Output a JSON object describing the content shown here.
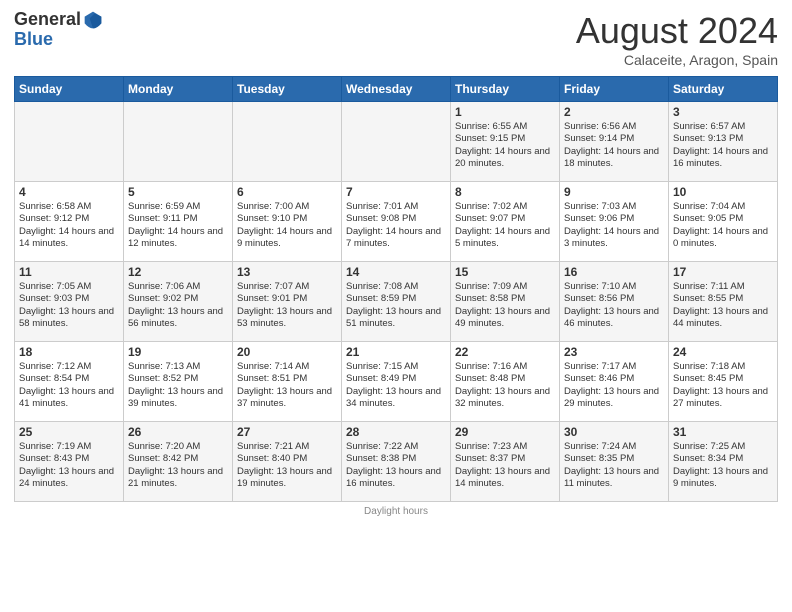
{
  "header": {
    "logo_general": "General",
    "logo_blue": "Blue",
    "month_title": "August 2024",
    "location": "Calaceite, Aragon, Spain"
  },
  "weekdays": [
    "Sunday",
    "Monday",
    "Tuesday",
    "Wednesday",
    "Thursday",
    "Friday",
    "Saturday"
  ],
  "weeks": [
    [
      {
        "day": "",
        "info": ""
      },
      {
        "day": "",
        "info": ""
      },
      {
        "day": "",
        "info": ""
      },
      {
        "day": "",
        "info": ""
      },
      {
        "day": "1",
        "info": "Sunrise: 6:55 AM\nSunset: 9:15 PM\nDaylight: 14 hours and 20 minutes."
      },
      {
        "day": "2",
        "info": "Sunrise: 6:56 AM\nSunset: 9:14 PM\nDaylight: 14 hours and 18 minutes."
      },
      {
        "day": "3",
        "info": "Sunrise: 6:57 AM\nSunset: 9:13 PM\nDaylight: 14 hours and 16 minutes."
      }
    ],
    [
      {
        "day": "4",
        "info": "Sunrise: 6:58 AM\nSunset: 9:12 PM\nDaylight: 14 hours and 14 minutes."
      },
      {
        "day": "5",
        "info": "Sunrise: 6:59 AM\nSunset: 9:11 PM\nDaylight: 14 hours and 12 minutes."
      },
      {
        "day": "6",
        "info": "Sunrise: 7:00 AM\nSunset: 9:10 PM\nDaylight: 14 hours and 9 minutes."
      },
      {
        "day": "7",
        "info": "Sunrise: 7:01 AM\nSunset: 9:08 PM\nDaylight: 14 hours and 7 minutes."
      },
      {
        "day": "8",
        "info": "Sunrise: 7:02 AM\nSunset: 9:07 PM\nDaylight: 14 hours and 5 minutes."
      },
      {
        "day": "9",
        "info": "Sunrise: 7:03 AM\nSunset: 9:06 PM\nDaylight: 14 hours and 3 minutes."
      },
      {
        "day": "10",
        "info": "Sunrise: 7:04 AM\nSunset: 9:05 PM\nDaylight: 14 hours and 0 minutes."
      }
    ],
    [
      {
        "day": "11",
        "info": "Sunrise: 7:05 AM\nSunset: 9:03 PM\nDaylight: 13 hours and 58 minutes."
      },
      {
        "day": "12",
        "info": "Sunrise: 7:06 AM\nSunset: 9:02 PM\nDaylight: 13 hours and 56 minutes."
      },
      {
        "day": "13",
        "info": "Sunrise: 7:07 AM\nSunset: 9:01 PM\nDaylight: 13 hours and 53 minutes."
      },
      {
        "day": "14",
        "info": "Sunrise: 7:08 AM\nSunset: 8:59 PM\nDaylight: 13 hours and 51 minutes."
      },
      {
        "day": "15",
        "info": "Sunrise: 7:09 AM\nSunset: 8:58 PM\nDaylight: 13 hours and 49 minutes."
      },
      {
        "day": "16",
        "info": "Sunrise: 7:10 AM\nSunset: 8:56 PM\nDaylight: 13 hours and 46 minutes."
      },
      {
        "day": "17",
        "info": "Sunrise: 7:11 AM\nSunset: 8:55 PM\nDaylight: 13 hours and 44 minutes."
      }
    ],
    [
      {
        "day": "18",
        "info": "Sunrise: 7:12 AM\nSunset: 8:54 PM\nDaylight: 13 hours and 41 minutes."
      },
      {
        "day": "19",
        "info": "Sunrise: 7:13 AM\nSunset: 8:52 PM\nDaylight: 13 hours and 39 minutes."
      },
      {
        "day": "20",
        "info": "Sunrise: 7:14 AM\nSunset: 8:51 PM\nDaylight: 13 hours and 37 minutes."
      },
      {
        "day": "21",
        "info": "Sunrise: 7:15 AM\nSunset: 8:49 PM\nDaylight: 13 hours and 34 minutes."
      },
      {
        "day": "22",
        "info": "Sunrise: 7:16 AM\nSunset: 8:48 PM\nDaylight: 13 hours and 32 minutes."
      },
      {
        "day": "23",
        "info": "Sunrise: 7:17 AM\nSunset: 8:46 PM\nDaylight: 13 hours and 29 minutes."
      },
      {
        "day": "24",
        "info": "Sunrise: 7:18 AM\nSunset: 8:45 PM\nDaylight: 13 hours and 27 minutes."
      }
    ],
    [
      {
        "day": "25",
        "info": "Sunrise: 7:19 AM\nSunset: 8:43 PM\nDaylight: 13 hours and 24 minutes."
      },
      {
        "day": "26",
        "info": "Sunrise: 7:20 AM\nSunset: 8:42 PM\nDaylight: 13 hours and 21 minutes."
      },
      {
        "day": "27",
        "info": "Sunrise: 7:21 AM\nSunset: 8:40 PM\nDaylight: 13 hours and 19 minutes."
      },
      {
        "day": "28",
        "info": "Sunrise: 7:22 AM\nSunset: 8:38 PM\nDaylight: 13 hours and 16 minutes."
      },
      {
        "day": "29",
        "info": "Sunrise: 7:23 AM\nSunset: 8:37 PM\nDaylight: 13 hours and 14 minutes."
      },
      {
        "day": "30",
        "info": "Sunrise: 7:24 AM\nSunset: 8:35 PM\nDaylight: 13 hours and 11 minutes."
      },
      {
        "day": "31",
        "info": "Sunrise: 7:25 AM\nSunset: 8:34 PM\nDaylight: 13 hours and 9 minutes."
      }
    ]
  ],
  "footer": "Daylight hours"
}
